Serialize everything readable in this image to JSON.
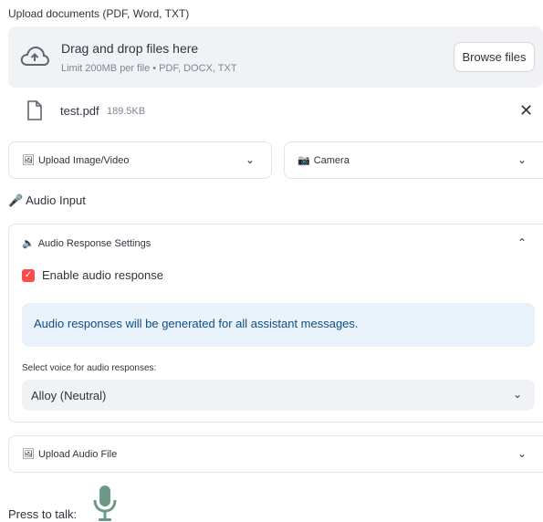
{
  "upload": {
    "label": "Upload documents (PDF, Word, TXT)",
    "drop_title": "Drag and drop files here",
    "drop_sub": "Limit 200MB per file • PDF, DOCX, TXT",
    "browse_label": "Browse files",
    "file": {
      "name": "test.pdf",
      "size": "189.5KB"
    }
  },
  "expanders": {
    "image": {
      "label": "Upload Image/Video",
      "icon": "framed-picture-icon"
    },
    "camera": {
      "label": "Camera",
      "icon": "camera-icon"
    },
    "audio_settings": {
      "label": "Audio Response Settings",
      "icon": "speaker-icon"
    },
    "audio_file": {
      "label": "Upload Audio File",
      "icon": "framed-picture-icon"
    }
  },
  "audio_input_label": "Audio Input",
  "audio_settings": {
    "checkbox_label": "Enable audio response",
    "checkbox_checked": true,
    "info_text": "Audio responses will be generated for all assistant messages.",
    "select_label": "Select voice for audio responses:",
    "select_value": "Alloy (Neutral)"
  },
  "press_to_talk": "Press to talk:",
  "colors": {
    "accent": "#ff4b4b",
    "mic": "#6a9b86",
    "info_bg": "#e9f2fb",
    "info_text": "#0e4f84"
  }
}
